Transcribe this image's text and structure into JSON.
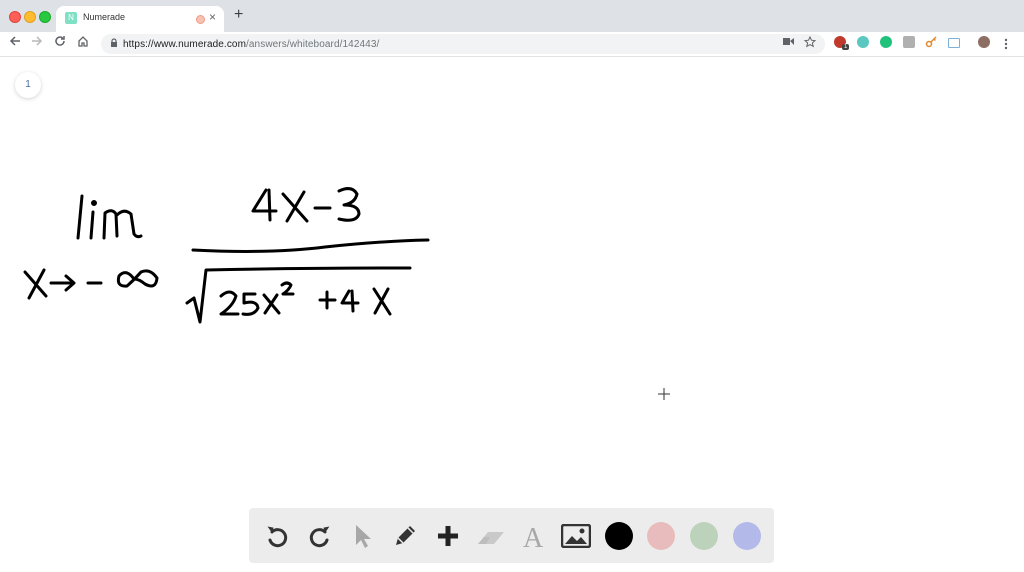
{
  "browser": {
    "tab_title": "Numerade",
    "url_host": "https://www.numerade.com",
    "url_path": "/answers/whiteboard/142443/",
    "new_tab": "+",
    "tab_close": "×",
    "extension_badge": "1",
    "favicon_letter": "N"
  },
  "whiteboard": {
    "page_number": "1",
    "expression": {
      "lim": "lim",
      "subscript": "X→ - ∞",
      "numerator": "4X-3",
      "denominator": "25X² + 4X"
    }
  },
  "palette": {
    "tools": [
      "undo",
      "redo",
      "select",
      "pen",
      "add",
      "eraser",
      "text",
      "image"
    ],
    "colors": [
      "#000000",
      "#e8bcbc",
      "#bcd2bb",
      "#b3b9e8"
    ]
  }
}
